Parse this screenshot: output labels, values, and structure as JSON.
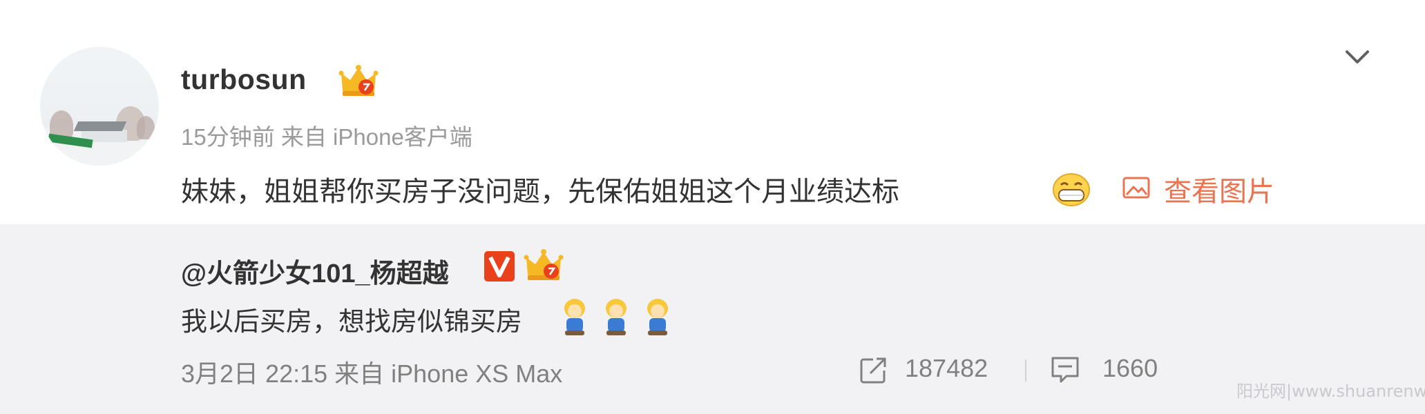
{
  "post": {
    "username": "turbosun",
    "meta": "15分钟前 来自 iPhone客户端",
    "content": "妹妹，姐姐帮你买房子没问题，先保佑姐姐这个月业绩达标",
    "view_picture_label": "查看图片",
    "icons": {
      "avatar": "avatar-snow-scene",
      "badge": "crown-icon",
      "menu": "chevron-down-icon",
      "emoji": "grin-emoji-icon",
      "picture": "picture-icon"
    }
  },
  "repost": {
    "username": "@火箭少女101_杨超越",
    "text": "我以后买房，想找房似锦买房",
    "meta": "3月2日 22:15 来自 iPhone XS Max",
    "share_count": "187482",
    "comment_count": "1660",
    "icons": {
      "verified": "verified-v-icon",
      "badge": "crown-icon",
      "emoji": "doll-emoji-icon",
      "share": "share-icon",
      "comment": "comment-icon"
    }
  },
  "watermark": "阳光网|www.shuanrenwu.net",
  "colors": {
    "accent": "#eb7350",
    "text": "#333333",
    "muted": "#9a9a9a",
    "repost_bg": "#f2f2f5",
    "verified": "#e8411b",
    "crown": "#f6b925"
  }
}
